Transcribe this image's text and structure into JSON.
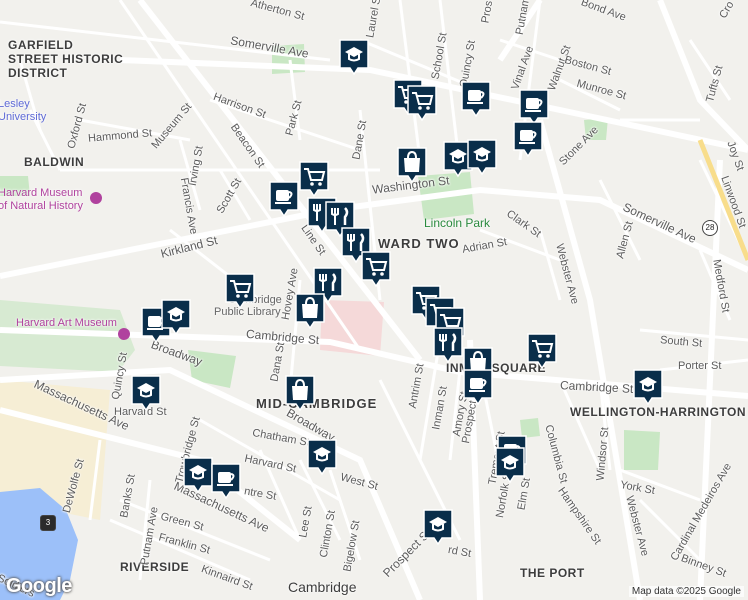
{
  "map": {
    "attribution": "Map data ©2025 Google",
    "logo": "Google",
    "route_shields": [
      "28",
      "3"
    ]
  },
  "areas": [
    {
      "id": "garfield1",
      "text": "GARFIELD"
    },
    {
      "id": "garfield2",
      "text": "STREET HISTORIC"
    },
    {
      "id": "garfield3",
      "text": "DISTRICT"
    },
    {
      "id": "baldwin",
      "text": "BALDWIN"
    },
    {
      "id": "wardtwo",
      "text": "WARD TWO"
    },
    {
      "id": "midcambridge",
      "text": "MID-CAMBRIDGE"
    },
    {
      "id": "wellington",
      "text": "WELLINGTON-HARRINGTON"
    },
    {
      "id": "riverside",
      "text": "RIVERSIDE"
    },
    {
      "id": "theport",
      "text": "THE PORT"
    },
    {
      "id": "cambridge",
      "text": "Cambridge"
    },
    {
      "id": "inmansq",
      "text": "INMAN SQUARE"
    }
  ],
  "pois": [
    {
      "id": "lesley1",
      "text": "Lesley"
    },
    {
      "id": "lesley2",
      "text": "University"
    },
    {
      "id": "harvardmuseum1",
      "text": "Harvard Museum"
    },
    {
      "id": "harvardmuseum2",
      "text": "of Natural History"
    },
    {
      "id": "harvardart",
      "text": "Harvard Art Museum"
    },
    {
      "id": "lincolnpark",
      "text": "Lincoln Park"
    },
    {
      "id": "library1",
      "text": "Cambridge"
    },
    {
      "id": "library2",
      "text": "Public Library"
    }
  ],
  "streets": [
    {
      "id": "atherton",
      "text": "Atherton St"
    },
    {
      "id": "laurel",
      "text": "Laurel St"
    },
    {
      "id": "somervilleave1",
      "text": "Somerville Ave"
    },
    {
      "id": "school",
      "text": "School St"
    },
    {
      "id": "quincy1",
      "text": "Quincy St"
    },
    {
      "id": "putnam1",
      "text": "Putnam"
    },
    {
      "id": "prospect1",
      "text": "Pros"
    },
    {
      "id": "vinal",
      "text": "Vinal Ave"
    },
    {
      "id": "walnut",
      "text": "Walnut St"
    },
    {
      "id": "boston",
      "text": "Boston St"
    },
    {
      "id": "munroe",
      "text": "Munroe St"
    },
    {
      "id": "bond",
      "text": "Bond Ave"
    },
    {
      "id": "tufts",
      "text": "Tufts St"
    },
    {
      "id": "harrison",
      "text": "Harrison St"
    },
    {
      "id": "park",
      "text": "Park St"
    },
    {
      "id": "dane",
      "text": "Dane St"
    },
    {
      "id": "hammond",
      "text": "Hammond St"
    },
    {
      "id": "museum",
      "text": "Museum St"
    },
    {
      "id": "oxford",
      "text": "Oxford St"
    },
    {
      "id": "beacon",
      "text": "Beacon St"
    },
    {
      "id": "stone",
      "text": "Stone Ave"
    },
    {
      "id": "washington",
      "text": "Washington St"
    },
    {
      "id": "irving",
      "text": "Irving St"
    },
    {
      "id": "francis",
      "text": "Francis Ave"
    },
    {
      "id": "scott",
      "text": "Scott St"
    },
    {
      "id": "kirkland",
      "text": "Kirkland St"
    },
    {
      "id": "line",
      "text": "Line St"
    },
    {
      "id": "clark",
      "text": "Clark St"
    },
    {
      "id": "somervilleave2",
      "text": "Somerville Ave"
    },
    {
      "id": "adrian",
      "text": "Adrian St"
    },
    {
      "id": "webster1",
      "text": "Webster Ave"
    },
    {
      "id": "allen",
      "text": "Allen St"
    },
    {
      "id": "medford",
      "text": "Medford St"
    },
    {
      "id": "linwood",
      "text": "Linwood St"
    },
    {
      "id": "joy",
      "text": "Joy St"
    },
    {
      "id": "hovey",
      "text": "Hovey Ave"
    },
    {
      "id": "cambridge1",
      "text": "Cambridge St"
    },
    {
      "id": "broadway1",
      "text": "Broadway"
    },
    {
      "id": "quincy2",
      "text": "Quincy St"
    },
    {
      "id": "harvard1",
      "text": "Harvard St"
    },
    {
      "id": "dana",
      "text": "Dana St"
    },
    {
      "id": "antrim",
      "text": "Antrim St"
    },
    {
      "id": "inman",
      "text": "Inman St"
    },
    {
      "id": "amory",
      "text": "Amory St"
    },
    {
      "id": "prospect2",
      "text": "Prospect"
    },
    {
      "id": "south",
      "text": "South St"
    },
    {
      "id": "porter",
      "text": "Porter St"
    },
    {
      "id": "cambridge2",
      "text": "Cambridge St"
    },
    {
      "id": "massave1",
      "text": "Massachusetts Ave"
    },
    {
      "id": "trowbridge",
      "text": "Trowbridge St"
    },
    {
      "id": "chatham",
      "text": "Chatham St"
    },
    {
      "id": "broadway2",
      "text": "Broadway"
    },
    {
      "id": "harvard2",
      "text": "Harvard St"
    },
    {
      "id": "west",
      "text": "West St"
    },
    {
      "id": "defwolfe",
      "text": "DeWolfe St"
    },
    {
      "id": "banks",
      "text": "Banks St"
    },
    {
      "id": "massave2",
      "text": "Massachusetts Ave"
    },
    {
      "id": "green",
      "text": "Green St"
    },
    {
      "id": "franklin",
      "text": "Franklin St"
    },
    {
      "id": "putnam2",
      "text": "Putnam Ave"
    },
    {
      "id": "lee",
      "text": "Lee St"
    },
    {
      "id": "clinton",
      "text": "Clinton St"
    },
    {
      "id": "bigelow",
      "text": "Bigelow St"
    },
    {
      "id": "kinnaird",
      "text": "Kinnaird St"
    },
    {
      "id": "prospect3",
      "text": "Prospect St"
    },
    {
      "id": "harvard3",
      "text": "rd St"
    },
    {
      "id": "tremont",
      "text": "Tremont St"
    },
    {
      "id": "norfolk",
      "text": "Norfolk St"
    },
    {
      "id": "elm",
      "text": "Elm St"
    },
    {
      "id": "columbia",
      "text": "Columbia St"
    },
    {
      "id": "hampshire",
      "text": "Hampshire St"
    },
    {
      "id": "windsor",
      "text": "Windsor St"
    },
    {
      "id": "york",
      "text": "York St"
    },
    {
      "id": "webster2",
      "text": "Webster Ave"
    },
    {
      "id": "cardinal",
      "text": "Cardinal Medeiros Ave"
    },
    {
      "id": "binney",
      "text": "Binney St"
    },
    {
      "id": "soldiers",
      "text": "Soldiers"
    },
    {
      "id": "crossst",
      "text": "Cro"
    },
    {
      "id": "centre",
      "text": "ntre St"
    }
  ],
  "markers": [
    {
      "type": "school"
    },
    {
      "type": "shopping-cart"
    },
    {
      "type": "shopping-cart"
    },
    {
      "type": "cafe"
    },
    {
      "type": "cafe"
    },
    {
      "type": "cafe"
    },
    {
      "type": "school"
    },
    {
      "type": "school"
    },
    {
      "type": "shopping-bag"
    },
    {
      "type": "shopping-cart"
    },
    {
      "type": "cafe"
    },
    {
      "type": "restaurant"
    },
    {
      "type": "restaurant"
    },
    {
      "type": "restaurant"
    },
    {
      "type": "shopping-cart"
    },
    {
      "type": "restaurant"
    },
    {
      "type": "shopping-cart"
    },
    {
      "type": "shopping-cart"
    },
    {
      "type": "shopping-bag"
    },
    {
      "type": "cafe"
    },
    {
      "type": "school"
    },
    {
      "type": "shopping-cart"
    },
    {
      "type": "shopping-cart"
    },
    {
      "type": "restaurant"
    },
    {
      "type": "shopping-bag"
    },
    {
      "type": "cafe"
    },
    {
      "type": "shopping-cart"
    },
    {
      "type": "school"
    },
    {
      "type": "shopping-bag"
    },
    {
      "type": "school"
    },
    {
      "type": "school"
    },
    {
      "type": "cafe"
    },
    {
      "type": "school"
    },
    {
      "type": "school"
    },
    {
      "type": "cafe"
    },
    {
      "type": "school"
    }
  ]
}
